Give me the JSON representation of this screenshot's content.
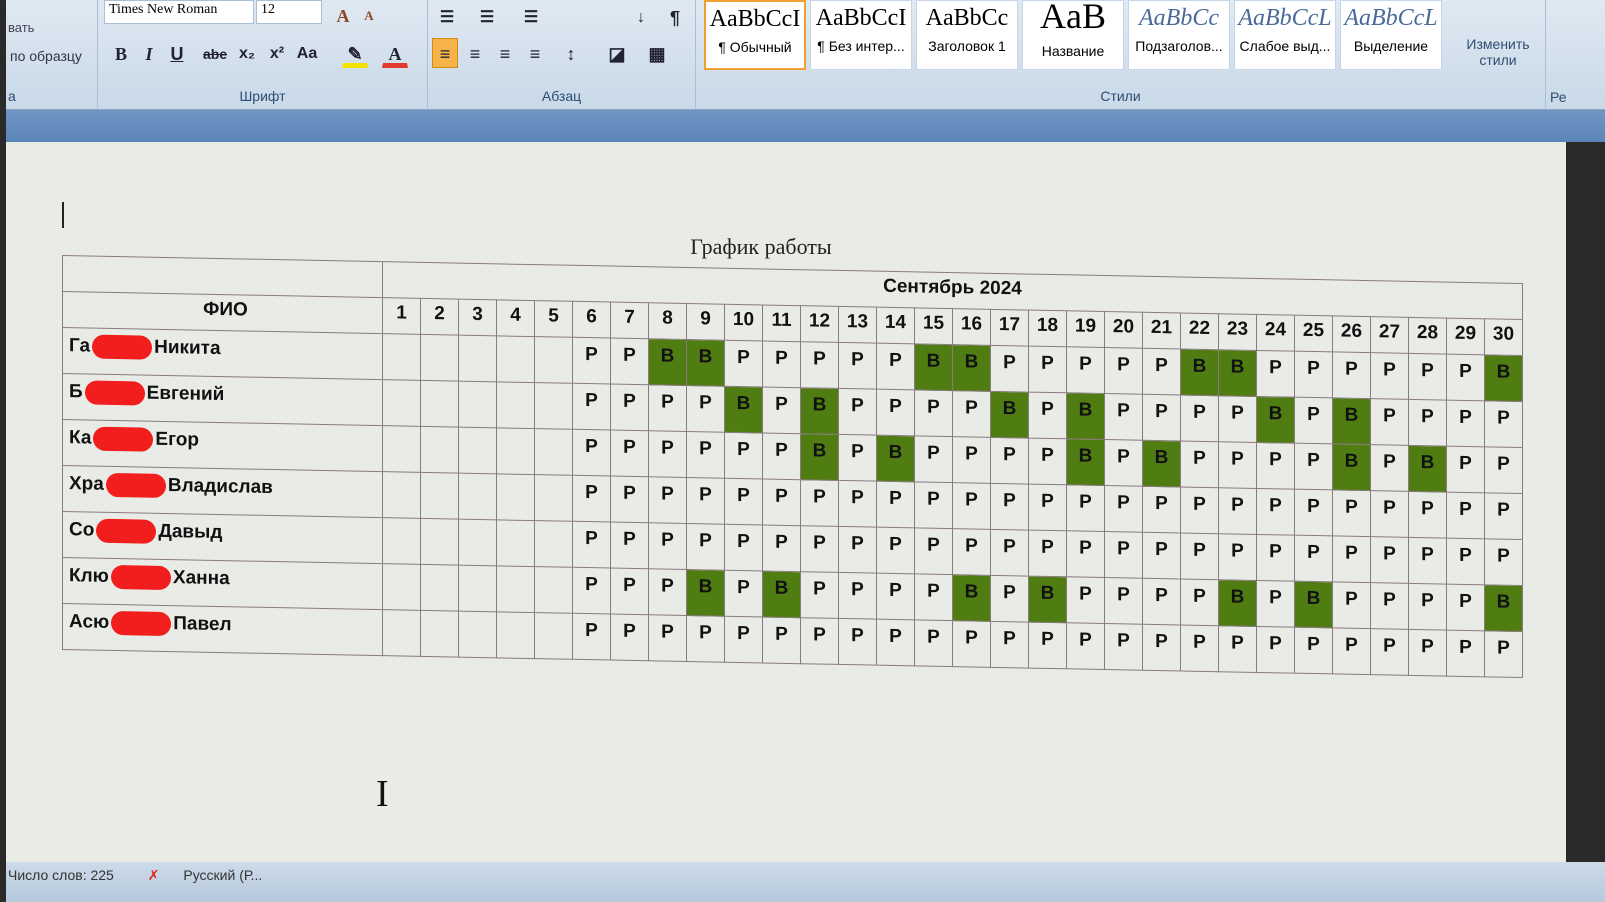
{
  "ribbon": {
    "clipboard": {
      "cut_text": "вать",
      "format_painter": "по образцу",
      "group_label": "а"
    },
    "font": {
      "name": "Times New Roman",
      "size": "12",
      "group_label": "Шрифт",
      "bold": "B",
      "italic": "I",
      "underline": "U",
      "strike": "abe",
      "sub": "x₂",
      "sup": "x²",
      "case": "Aa",
      "grow": "A",
      "shrink": "A",
      "color_highlight": "#f2e200",
      "color_font": "#e23b2e"
    },
    "paragraph": {
      "group_label": "Абзац"
    },
    "styles": {
      "group_label": "Стили",
      "items": [
        {
          "preview": "AaBbCcI",
          "label": "¶ Обычный"
        },
        {
          "preview": "AaBbCcI",
          "label": "¶ Без интер..."
        },
        {
          "preview": "AaBbCc",
          "label": "Заголовок 1"
        },
        {
          "preview": "AaB",
          "label": "Название"
        },
        {
          "preview": "AaBbCc",
          "label": "Подзаголов..."
        },
        {
          "preview": "AaBbCcL",
          "label": "Слабое выд..."
        },
        {
          "preview": "AaBbCcL",
          "label": "Выделение"
        }
      ],
      "change_styles": "Изменить стили"
    },
    "editing_label": "Ре"
  },
  "document": {
    "title": "График работы",
    "month": "Сентябрь 2024",
    "name_header": "ФИО",
    "days": [
      "1",
      "2",
      "3",
      "4",
      "5",
      "6",
      "7",
      "8",
      "9",
      "10",
      "11",
      "12",
      "13",
      "14",
      "15",
      "16",
      "17",
      "18",
      "19",
      "20",
      "21",
      "22",
      "23",
      "24",
      "25",
      "26",
      "27",
      "28",
      "29",
      "30"
    ],
    "colors": {
      "day_off": "#4f7d12"
    },
    "rows": [
      {
        "prefix": "Га",
        "first": "Никита",
        "schedule": "     РРВВРРРРРВВРРРРРВВРРРРРРВ"
      },
      {
        "prefix": "Б",
        "first": "Евгений",
        "schedule": "     РРРРВРВРРРРВРВРРРРВРВРРРР"
      },
      {
        "prefix": "Ка",
        "first": "Егор",
        "schedule": "     РРРРРРВРВРРРРВРВРРРРВРВРР"
      },
      {
        "prefix": "Хра",
        "first": "Владислав",
        "schedule": "     РРРРРРРРРРРРРРРРРРРРРРРРР"
      },
      {
        "prefix": "Со",
        "first": "Давыд",
        "schedule": "     РРРРРРРРРРРРРРРРРРРРРРРРР"
      },
      {
        "prefix": "Клю",
        "first": "Ханна",
        "schedule": "     РРРВРВРРРРВРВРРРРВРВРРРРВ"
      },
      {
        "prefix": "Асю",
        "first": "Павел",
        "schedule": "     РРРРРРРРРРРРРРРРРРРРРРРРР"
      }
    ]
  },
  "status": {
    "word_count": "Число слов: 225",
    "language": "Русский (Р..."
  }
}
